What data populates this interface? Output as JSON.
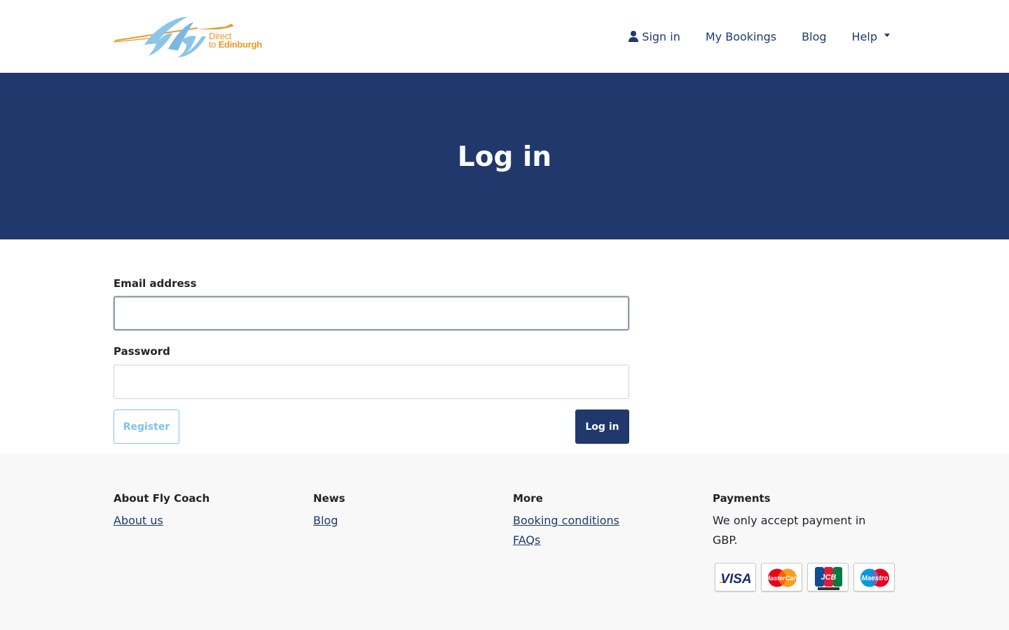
{
  "header": {
    "logo": {
      "word": "fly",
      "line1": "Direct",
      "line2_prefix": "to ",
      "line2_bold": "Edinburgh"
    },
    "nav": {
      "sign_in": "Sign in",
      "my_bookings": "My Bookings",
      "blog": "Blog",
      "help": "Help"
    }
  },
  "hero": {
    "title": "Log in"
  },
  "form": {
    "email_label": "Email address",
    "email_value": "",
    "password_label": "Password",
    "password_value": "",
    "register_label": "Register",
    "login_label": "Log in"
  },
  "footer": {
    "about": {
      "heading": "About Fly Coach",
      "links": [
        "About us"
      ]
    },
    "news": {
      "heading": "News",
      "links": [
        "Blog"
      ]
    },
    "more": {
      "heading": "More",
      "links": [
        "Booking conditions",
        "FAQs"
      ]
    },
    "payments": {
      "heading": "Payments",
      "text": "We only accept payment in GBP.",
      "cards": [
        "VISA",
        "MasterCard",
        "JCB",
        "Maestro"
      ]
    }
  },
  "colors": {
    "primary": "#21386d",
    "accent_light": "#7ec3e8",
    "logo_orange": "#e8992a",
    "footer_bg": "#f8f8f8"
  },
  "icons": {
    "sign_in": "user-icon",
    "help": "caret-down-icon"
  }
}
